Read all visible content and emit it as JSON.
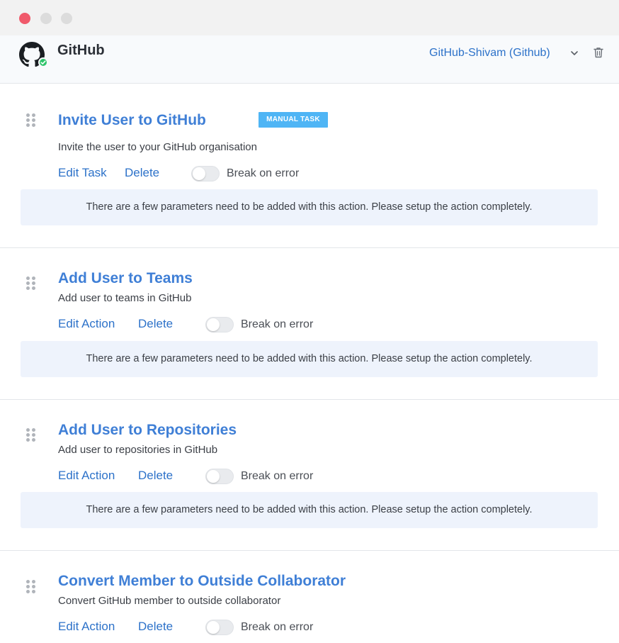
{
  "window": {
    "controls": [
      "close",
      "minimize",
      "maximize"
    ]
  },
  "header": {
    "app_name": "GitHub",
    "app_icon": "github-logo-icon",
    "status_icon": "connected-check-icon",
    "account_selector": "GitHub-Shivam (Github)",
    "dropdown_icon": "chevron-down-icon",
    "delete_icon": "trash-icon"
  },
  "tasks": [
    {
      "title": "Invite User to GitHub",
      "badge": "MANUAL TASK",
      "description": "Invite the user to your GitHub organisation",
      "edit_label": "Edit Task",
      "delete_label": "Delete",
      "toggle_label": "Break on error",
      "break_on_error": false,
      "notice": "There are a few parameters need to be added with this action. Please setup the action completely."
    },
    {
      "title": "Add User to Teams",
      "description": "Add user to teams in GitHub",
      "edit_label": "Edit Action",
      "delete_label": "Delete",
      "toggle_label": "Break on error",
      "break_on_error": false,
      "notice": "There are a few parameters need to be added with this action. Please setup the action completely."
    },
    {
      "title": "Add User to Repositories",
      "description": "Add user to repositories in GitHub",
      "edit_label": "Edit Action",
      "delete_label": "Delete",
      "toggle_label": "Break on error",
      "break_on_error": false,
      "notice": "There are a few parameters need to be added with this action. Please setup the action completely."
    },
    {
      "title": "Convert Member to Outside Collaborator",
      "description": "Convert GitHub member to outside collaborator",
      "edit_label": "Edit Action",
      "delete_label": "Delete",
      "toggle_label": "Break on error",
      "break_on_error": false
    }
  ],
  "colors": {
    "accent": "#3f7fd6",
    "link": "#2d72c9",
    "badge": "#4fb5f5",
    "notice_bg": "#eef3fc",
    "close_dot": "#f05a6b",
    "status_green": "#2fc46b"
  }
}
